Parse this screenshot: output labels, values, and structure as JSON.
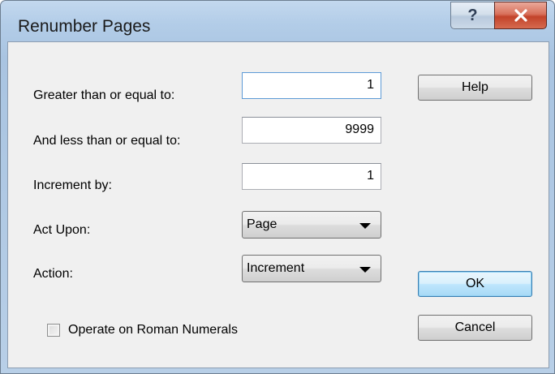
{
  "window": {
    "title": "Renumber Pages",
    "help_glyph": "?",
    "close_glyph": "X"
  },
  "fields": {
    "greater_than_label": "Greater than or equal to:",
    "greater_than_value": "1",
    "less_than_label": "And less than or equal to:",
    "less_than_value": "9999",
    "increment_label": "Increment by:",
    "increment_value": "1"
  },
  "selects": {
    "act_upon_label": "Act Upon:",
    "act_upon_value": "Page",
    "action_label": "Action:",
    "action_value": "Increment"
  },
  "checkbox": {
    "label": "Operate on Roman Numerals",
    "checked": false
  },
  "buttons": {
    "help": "Help",
    "ok": "OK",
    "cancel": "Cancel"
  },
  "colors": {
    "title_bar": "#b3cde8",
    "close_button": "#c2432a",
    "client_bg": "#f0f0f0",
    "focus_border": "#5d9ad6"
  }
}
